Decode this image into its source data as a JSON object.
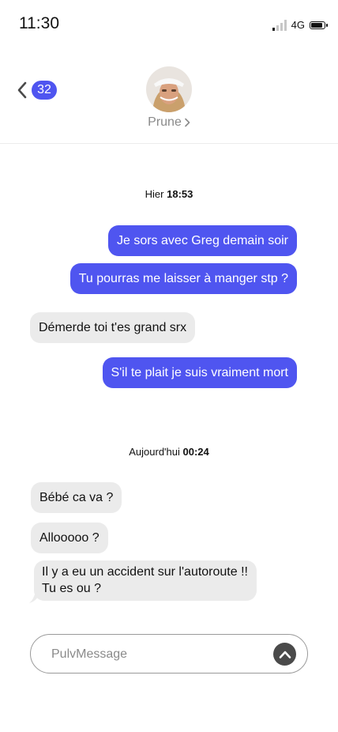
{
  "status": {
    "time": "11:30",
    "network": "4G",
    "battery_level": 0.85,
    "signal_bars_on": 1,
    "signal_bars_total": 4
  },
  "header": {
    "back_count": "32",
    "contact_name": "Prune"
  },
  "days": [
    {
      "prefix": "Hier",
      "time": "18:53"
    },
    {
      "prefix": "Aujourd'hui",
      "time": "00:24"
    }
  ],
  "messages": [
    {
      "from": "me",
      "text": "Je sors avec Greg demain soir"
    },
    {
      "from": "me",
      "text": "Tu pourras me laisser à manger stp ?"
    },
    {
      "from": "them",
      "text": "Démerde toi t'es grand srx"
    },
    {
      "from": "me",
      "text": "S'il te plait je suis vraiment mort"
    },
    {
      "from": "them",
      "text": "Bébé ca va ?"
    },
    {
      "from": "them",
      "text": "Allooooo ?"
    },
    {
      "from": "them",
      "lines": [
        "Il y a eu un accident sur l'autoroute !!",
        "Tu es ou ?"
      ]
    }
  ],
  "composer": {
    "placeholder": "PulvMessage"
  },
  "colors": {
    "accent": "#4f55f0",
    "incoming": "#ebebeb"
  }
}
